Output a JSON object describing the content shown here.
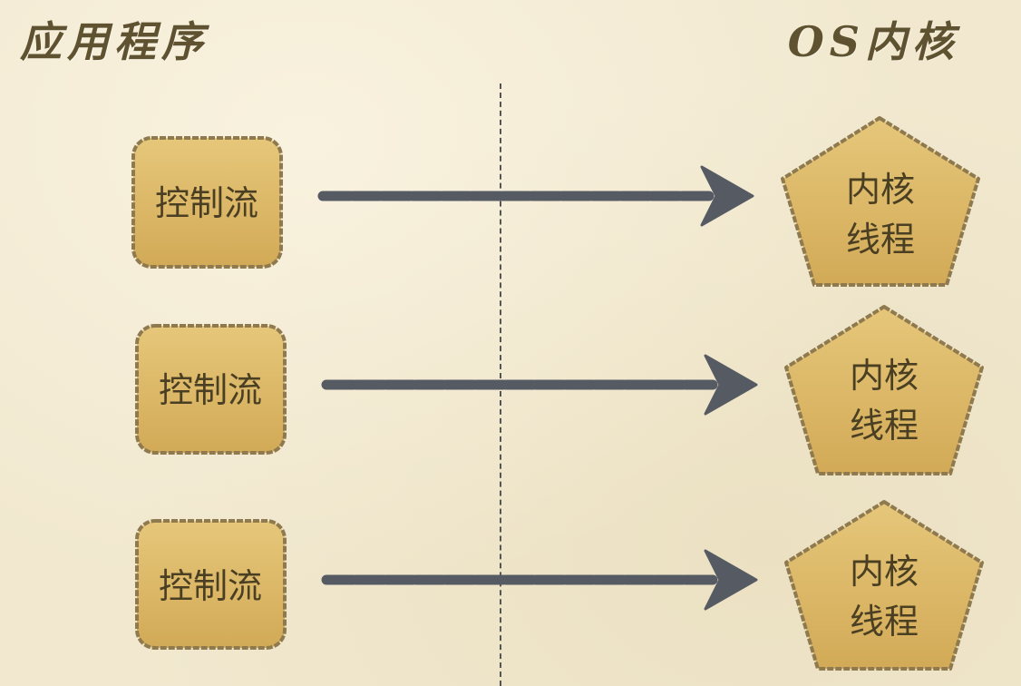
{
  "headings": {
    "left": "应用程序",
    "right": "OS内核"
  },
  "rows": [
    {
      "control_flow": "控制流",
      "kernel_thread": [
        "内核",
        "线程"
      ]
    },
    {
      "control_flow": "控制流",
      "kernel_thread": [
        "内核",
        "线程"
      ]
    },
    {
      "control_flow": "控制流",
      "kernel_thread": [
        "内核",
        "线程"
      ]
    }
  ],
  "colors": {
    "background": "#f1e8cf",
    "box_fill": "#dcb765",
    "box_stroke": "#8f7a4f",
    "arrow": "#565a63",
    "text": "#4a3f23",
    "heading": "#5e5230"
  }
}
